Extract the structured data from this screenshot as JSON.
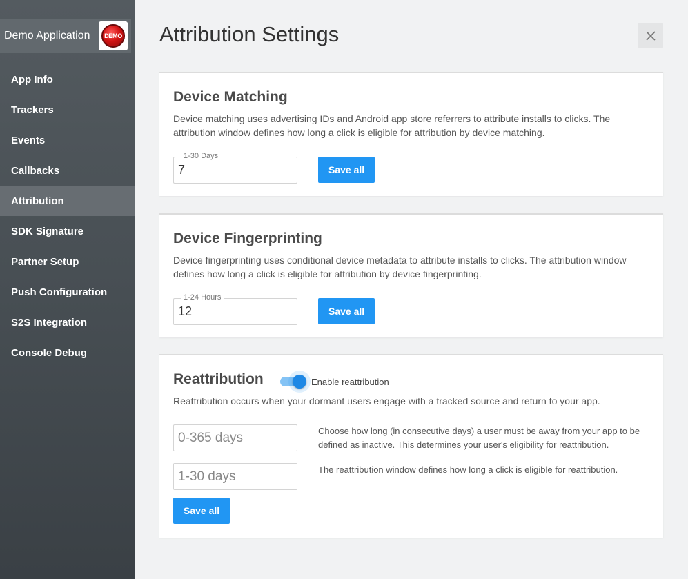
{
  "sidebar": {
    "app_name": "Demo Application",
    "logo_text": "DEMO",
    "items": [
      {
        "label": "App Info"
      },
      {
        "label": "Trackers"
      },
      {
        "label": "Events"
      },
      {
        "label": "Callbacks"
      },
      {
        "label": "Attribution",
        "active": true
      },
      {
        "label": "SDK Signature"
      },
      {
        "label": "Partner Setup"
      },
      {
        "label": "Push Configuration"
      },
      {
        "label": "S2S Integration"
      },
      {
        "label": "Console Debug"
      }
    ]
  },
  "page": {
    "title": "Attribution Settings",
    "close_icon": "close-icon"
  },
  "device_matching": {
    "title": "Device Matching",
    "description": "Device matching uses advertising IDs and Android app store referrers to attribute installs to clicks. The attribution window defines how long a click is eligible for attribution by device matching.",
    "field_label": "1-30 Days",
    "field_value": "7",
    "save_label": "Save all"
  },
  "device_fingerprinting": {
    "title": "Device Fingerprinting",
    "description": "Device fingerprinting uses conditional device metadata to attribute installs to clicks. The attribution window defines how long a click is eligible for attribution by device fingerprinting.",
    "field_label": "1-24 Hours",
    "field_value": "12",
    "save_label": "Save all"
  },
  "reattribution": {
    "title": "Reattribution",
    "toggle_label": "Enable reattribution",
    "toggle_on": true,
    "description": "Reattribution occurs when your dormant users engage with a tracked source and return to your app.",
    "inactive_placeholder": "0-365 days",
    "inactive_help": "Choose how long (in consecutive days) a user must be away from your app to be defined as inactive. This determines your user's eligibility for reattribution.",
    "window_placeholder": "1-30 days",
    "window_help": "The reattribution window defines how long a click is eligible for reattribution.",
    "save_label": "Save all"
  },
  "colors": {
    "accent": "#2196f3",
    "sidebar_bg": "#4a5156",
    "sidebar_active": "#676d72"
  }
}
